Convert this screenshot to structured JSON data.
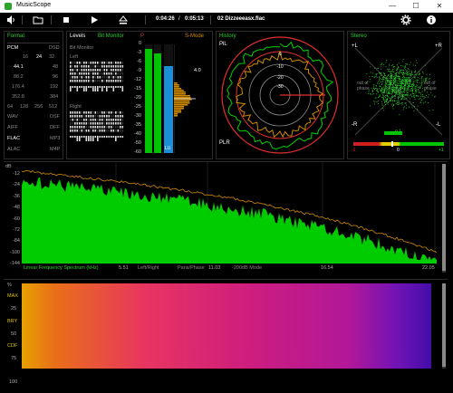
{
  "window": {
    "title": "MusicScope",
    "minimize_glyph": "—",
    "maximize_glyph": "☐",
    "close_glyph": "✕"
  },
  "toolbar": {
    "elapsed": "0:04:26",
    "separator": "/",
    "duration": "0:05:13",
    "filename": "02 Dizzeeeasx.flac",
    "icons": [
      "volume-icon",
      "folder-icon",
      "stop-icon",
      "play-icon",
      "eject-icon",
      "settings-icon",
      "info-icon"
    ]
  },
  "format": {
    "title": "Format",
    "rows": [
      {
        "left": "PCM",
        "mid": "",
        "mid2": "",
        "right": "DSD"
      },
      {
        "left": "",
        "mid": "16",
        "mid2": "24",
        "right": "32"
      },
      {
        "left": "44.1",
        "mid": "",
        "mid2": "",
        "right": "48"
      },
      {
        "left": "88.2",
        "mid": "",
        "mid2": "",
        "right": "96"
      },
      {
        "left": "176.4",
        "mid": "",
        "mid2": "",
        "right": "192"
      },
      {
        "left": "352.8",
        "mid": "",
        "mid2": "",
        "right": "384"
      }
    ],
    "dsd_row": [
      "64",
      "128",
      "256",
      "512"
    ],
    "containers": [
      {
        "left": "WAV",
        "right": "DSF"
      },
      {
        "left": "AIFF",
        "right": "DFF"
      },
      {
        "left": "FLAC",
        "right": "MP3"
      },
      {
        "left": "ALAC",
        "right": "M4P"
      }
    ]
  },
  "levels": {
    "title": "Levels",
    "mode_label": "Bit Monitor",
    "bit_monitor_label": "Bit Monitor",
    "left_label": "Left",
    "right_label": "Right",
    "peak_label": "P",
    "smode_label": "S-Mode",
    "scale": [
      "0",
      "-3",
      "-6",
      "-9",
      "-12",
      "-15",
      "-20",
      "-25",
      "-30",
      "-35",
      "-40",
      "-50",
      "-60"
    ],
    "peak_readout": "4.0",
    "lu_label": "LU",
    "left_level": 0.96,
    "right_level": 0.92,
    "lu_level": 0.8
  },
  "history": {
    "title": "History",
    "pl_label": "PlL",
    "plr_label": "PLR",
    "rings": [
      "-30",
      "-20",
      "-10",
      "-5"
    ]
  },
  "stereo": {
    "title": "Stereo",
    "plus_l": "+L",
    "plus_r": "+R",
    "minus_l": "-R",
    "minus_r": "-L",
    "out_of_phase_left": "out of phase",
    "out_of_phase_right": "out of phase",
    "scale_min": "-1",
    "scale_mid": "0",
    "scale_max": "+1",
    "corr_value": "0.1"
  },
  "spectrum": {
    "unit_label": "dB",
    "y_ticks": [
      "-12",
      "-24",
      "-36",
      "-48",
      "-60",
      "-72",
      "-84",
      "-100",
      "-144"
    ],
    "mode_labels": {
      "linear": "Linear Frequency Spectrum (kHz)",
      "channel": "Left/Right",
      "pans": "Pans/Phase",
      "mode": "-200dB Mode"
    },
    "x_ticks": [
      "5.51",
      "11.03",
      "16.54",
      "22.05"
    ]
  },
  "spectrogram": {
    "unit_label": "%",
    "y_labels": [
      "MAX",
      "25",
      "BRY",
      "50",
      "CDF",
      "75",
      "100"
    ]
  },
  "colors": {
    "green": "#00d100",
    "orange": "#d08a00",
    "accent_red": "#e03030",
    "blue": "#1a8fd8"
  }
}
